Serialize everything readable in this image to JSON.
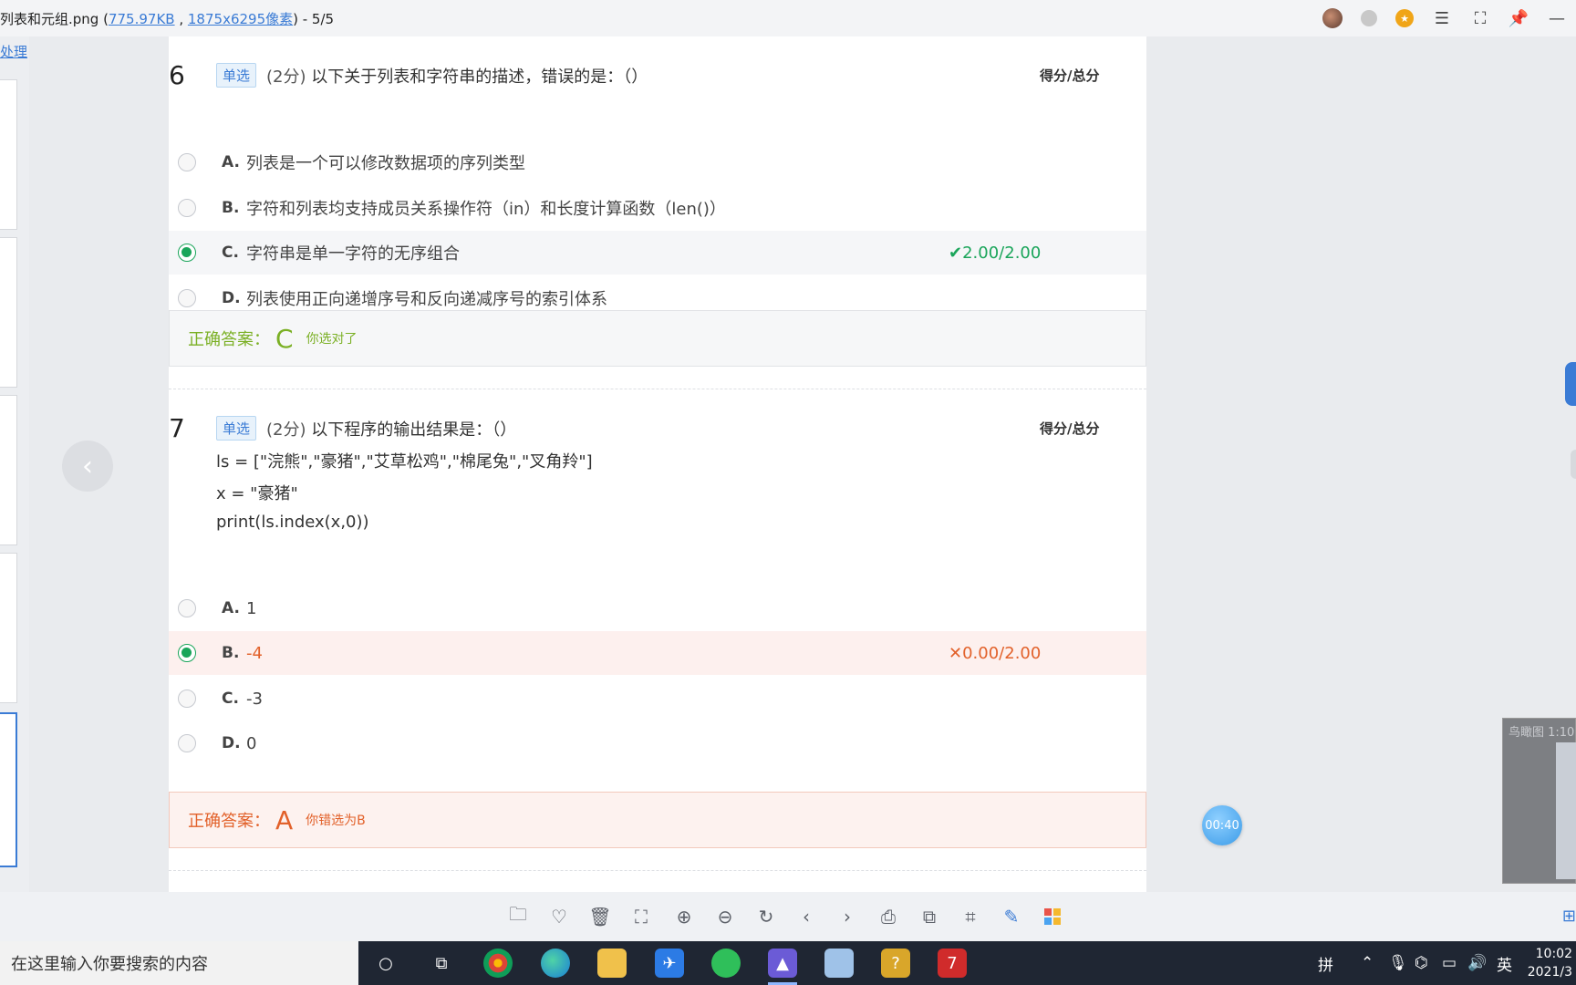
{
  "titlebar": {
    "filename": "列表和元组.png (",
    "size": "775.97KB",
    "sep": " , ",
    "dims": "1875x6295像素",
    "tail": ") - 5/5"
  },
  "leftstrip": {
    "link": "处理"
  },
  "questions": [
    {
      "num": "6",
      "tag": "单选",
      "points": "(2分)",
      "text": "以下关于列表和字符串的描述，错误的是：（）",
      "score_label": "得分/总分",
      "options": [
        {
          "letter": "A.",
          "text": "列表是一个可以修改数据项的序列类型",
          "selected": false,
          "score": ""
        },
        {
          "letter": "B.",
          "text": "字符和列表均支持成员关系操作符（in）和长度计算函数（len()）",
          "selected": false,
          "score": ""
        },
        {
          "letter": "C.",
          "text": "字符串是单一字符的无序组合",
          "selected": true,
          "score": "2.00/2.00"
        },
        {
          "letter": "D.",
          "text": "列表使用正向递增序号和反向递减序号的索引体系",
          "selected": false,
          "score": ""
        }
      ],
      "answer": {
        "label": "正确答案：",
        "letter": "C",
        "note": "你选对了"
      }
    },
    {
      "num": "7",
      "tag": "单选",
      "points": "(2分)",
      "text": "以下程序的输出结果是：（）",
      "score_label": "得分/总分",
      "code": [
        "ls = [\"浣熊\",\"豪猪\",\"艾草松鸡\",\"棉尾兔\",\"叉角羚\"]",
        "x = \"豪猪\"",
        "print(ls.index(x,0))"
      ],
      "options": [
        {
          "letter": "A.",
          "text": "1",
          "selected": false,
          "score": ""
        },
        {
          "letter": "B.",
          "text": "-4",
          "selected": true,
          "score": "0.00/2.00"
        },
        {
          "letter": "C.",
          "text": "-3",
          "selected": false,
          "score": ""
        },
        {
          "letter": "D.",
          "text": "0",
          "selected": false,
          "score": ""
        }
      ],
      "answer": {
        "label": "正确答案：",
        "letter": "A",
        "note": "你错选为B"
      }
    }
  ],
  "timer": "00:40",
  "birdseye": {
    "label": "鸟瞰图 1:10"
  },
  "taskbar": {
    "search_placeholder": "在这里输入你要搜索的内容",
    "ime_mode": "拼",
    "lang": "英",
    "time": "10:02",
    "date": "2021/3"
  },
  "colors": {
    "correct": "#1aa55a",
    "answer_ok": "#7bb025",
    "wrong": "#e2612a",
    "link": "#3a7bd5"
  }
}
